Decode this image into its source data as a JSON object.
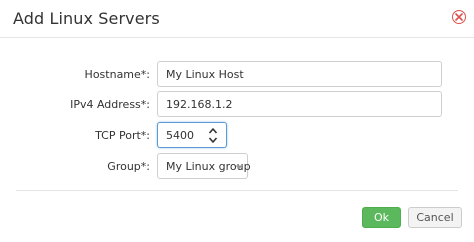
{
  "dialog": {
    "title": "Add Linux Servers",
    "close_icon": "close-circle-icon"
  },
  "form": {
    "hostname": {
      "label": "Hostname*:",
      "value": "My Linux Host"
    },
    "ipv4": {
      "label": "IPv4 Address*:",
      "value": "192.168.1.2"
    },
    "tcp_port": {
      "label": "TCP Port*:",
      "value": "5400",
      "spinner_icon": "spinner-arrows-icon"
    },
    "group": {
      "label": "Group*:",
      "selected": "My Linux group",
      "caret_icon": "chevron-down-icon"
    }
  },
  "footer": {
    "ok_label": "Ok",
    "cancel_label": "Cancel"
  },
  "colors": {
    "ok_button": "#5cb85c",
    "close_icon": "#d9534f",
    "focus_border": "#5b9bd5"
  }
}
